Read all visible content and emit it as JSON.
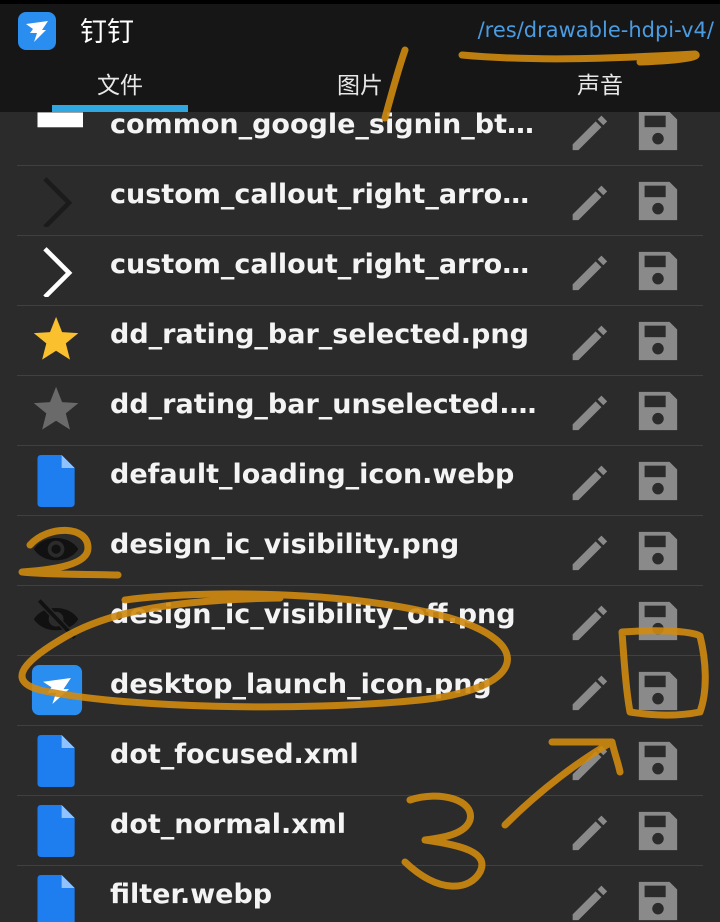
{
  "app": {
    "name": "钉钉",
    "path": "/res/drawable-hdpi-v4/",
    "logo_icon": "dingtalk-logo-icon"
  },
  "tabs": [
    {
      "label": "文件",
      "selected": true
    },
    {
      "label": "图片",
      "selected": false
    },
    {
      "label": "声音",
      "selected": false
    }
  ],
  "files": [
    {
      "name": "common_google_signin_btn_text_...",
      "thumb": "white-rect"
    },
    {
      "name": "custom_callout_right_arrow_bl..",
      "thumb": "dark-arrow"
    },
    {
      "name": "custom_callout_right_arrow_w..",
      "thumb": "white-arrow"
    },
    {
      "name": "dd_rating_bar_selected.png",
      "thumb": "gold-star"
    },
    {
      "name": "dd_rating_bar_unselected.png",
      "thumb": "grey-star"
    },
    {
      "name": "default_loading_icon.webp",
      "thumb": "file-icon"
    },
    {
      "name": "design_ic_visibility.png",
      "thumb": "eye-icon"
    },
    {
      "name": "design_ic_visibility_off.png",
      "thumb": "eye-off-icon"
    },
    {
      "name": "desktop_launch_icon.png",
      "thumb": "dingtalk-icon"
    },
    {
      "name": "dot_focused.xml",
      "thumb": "file-icon"
    },
    {
      "name": "dot_normal.xml",
      "thumb": "file-icon"
    },
    {
      "name": "filter.webp",
      "thumb": "file-icon"
    }
  ],
  "row_actions": {
    "edit_icon": "pencil-icon",
    "save_icon": "floppy-disk-icon"
  },
  "annotations": {
    "color": "#d08a10",
    "marks": [
      "1",
      "2",
      "3"
    ]
  },
  "colors": {
    "topbar_bg": "#161616",
    "list_bg": "#2b2b2b",
    "accent": "#2fa7e0",
    "path_text": "#4a9be0",
    "file_blue": "#1e7ef0",
    "icon_grey": "#8a8a8a"
  }
}
